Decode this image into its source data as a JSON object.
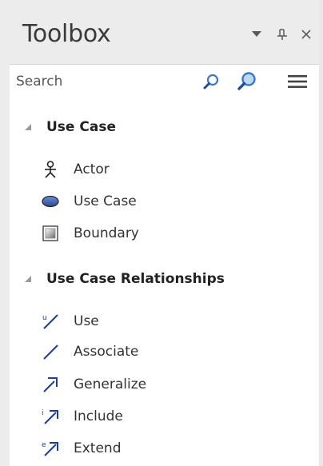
{
  "toolbox": {
    "title": "Toolbox",
    "controls": {
      "dropdown_icon": "dropdown-arrow-icon",
      "pin_icon": "pin-icon",
      "close_icon": "close-icon"
    }
  },
  "search": {
    "placeholder": "Search",
    "value": ""
  },
  "groups": [
    {
      "label": "Use Case",
      "expanded": true,
      "items": [
        {
          "label": "Actor",
          "icon": "actor-icon"
        },
        {
          "label": "Use Case",
          "icon": "use-case-ellipse-icon"
        },
        {
          "label": "Boundary",
          "icon": "boundary-icon"
        }
      ]
    },
    {
      "label": "Use Case Relationships",
      "expanded": true,
      "items": [
        {
          "label": "Use",
          "icon": "use-relationship-icon"
        },
        {
          "label": "Associate",
          "icon": "associate-icon"
        },
        {
          "label": "Generalize",
          "icon": "generalize-icon"
        },
        {
          "label": "Include",
          "icon": "include-icon"
        },
        {
          "label": "Extend",
          "icon": "extend-icon"
        }
      ]
    }
  ],
  "colors": {
    "titlebar_bg": "#ececec",
    "search_icon_blue": "#3b78c4",
    "relationship_line": "#1f3f8f"
  }
}
